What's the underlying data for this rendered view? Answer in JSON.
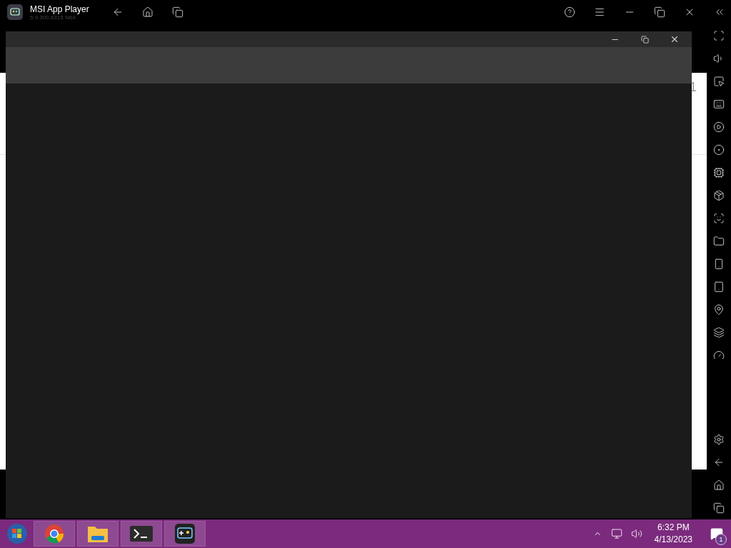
{
  "window": {
    "title": "MSI App Player",
    "version": "5.9.300.6315 N64"
  },
  "app_screen": {
    "edge_text": "1"
  },
  "taskbar": {
    "clock": {
      "time": "6:32 PM",
      "date": "4/13/2023"
    },
    "notifications": {
      "count": "1"
    }
  }
}
